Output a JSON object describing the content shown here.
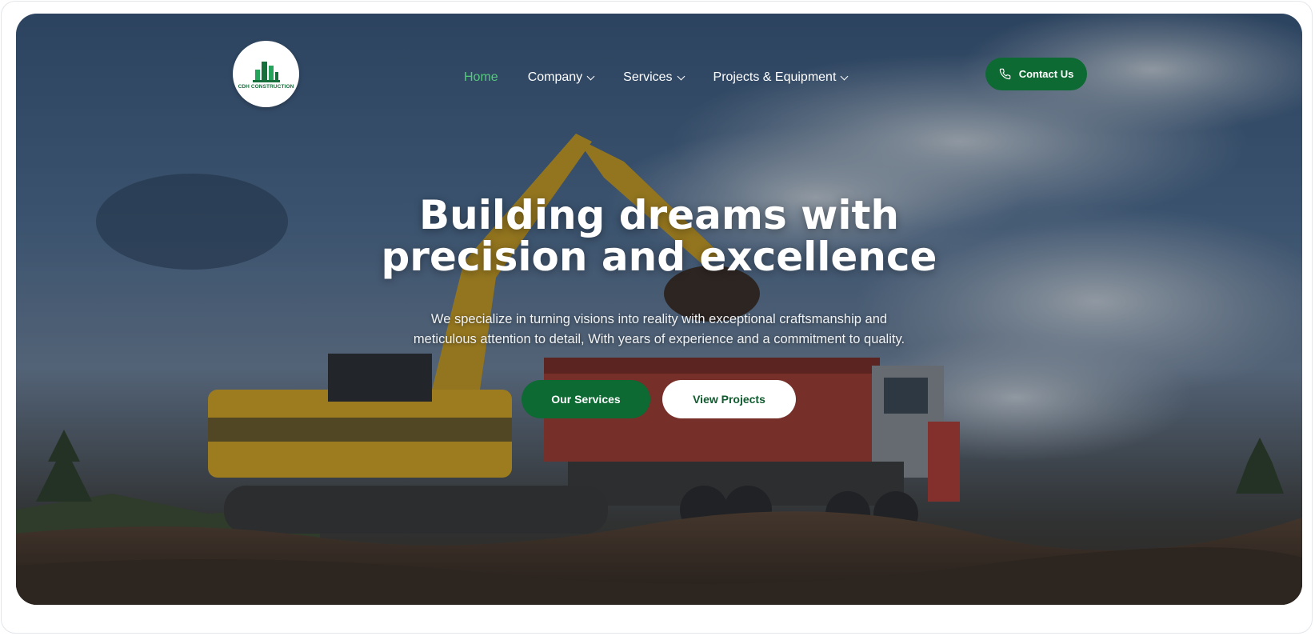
{
  "brand": {
    "logo_text": "CDH CONSTRUCTION",
    "accent_color": "#0d6a33",
    "active_nav_color": "#56c97e"
  },
  "nav": {
    "items": [
      {
        "label": "Home",
        "active": true,
        "dropdown": false
      },
      {
        "label": "Company",
        "active": false,
        "dropdown": true
      },
      {
        "label": "Services",
        "active": false,
        "dropdown": true
      },
      {
        "label": "Projects & Equipment",
        "active": false,
        "dropdown": true
      }
    ],
    "contact_label": "Contact Us",
    "contact_icon": "phone-icon"
  },
  "hero": {
    "title_line1": "Building dreams with",
    "title_line2": "precision and excellence",
    "subtitle_line1": "We specialize in turning visions into reality with exceptional craftsmanship and",
    "subtitle_line2": "meticulous attention to detail, With years of experience and a commitment to quality.",
    "primary_button": "Our Services",
    "secondary_button": "View Projects"
  }
}
